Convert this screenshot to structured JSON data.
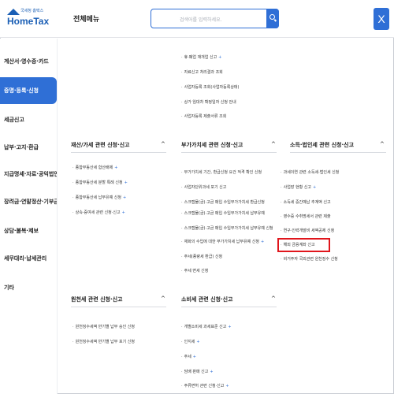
{
  "header": {
    "logo_small": "국세청 홈택스",
    "logo_big": "HomeTax",
    "menu_title": "전체메뉴",
    "search_placeholder": "검색어를 입력하세요.",
    "close_label": "X"
  },
  "sidebar": {
    "items": [
      {
        "label": "계산서·영수증·카드",
        "active": false
      },
      {
        "label": "증명·등록·신청",
        "active": true
      },
      {
        "label": "세금신고",
        "active": false
      },
      {
        "label": "납부·고지·환급",
        "active": false
      },
      {
        "label": "지급명세·자료·공익법인",
        "active": false
      },
      {
        "label": "장려금·연말정산·기부금",
        "active": false
      },
      {
        "label": "상담·불복·제보",
        "active": false
      },
      {
        "label": "세무대리·납세관리",
        "active": false
      },
      {
        "label": "기타",
        "active": false
      }
    ]
  },
  "top_list": [
    {
      "label": "휴·폐업 재개업 신고",
      "plus": true
    },
    {
      "label": "자료신고 처리결과 조회",
      "plus": false
    },
    {
      "label": "사업자등록 조회(사업자등록상태)",
      "plus": false
    },
    {
      "label": "상가 임대차 확정일자 신청 안내",
      "plus": false
    },
    {
      "label": "사업자등록 제출서류 조회",
      "plus": false
    }
  ],
  "sections": {
    "property": {
      "title": "재산/가세 관련 신청·신고",
      "caret": "^",
      "items": [
        {
          "label": "종합부동산세 합산배제",
          "plus": true
        },
        {
          "label": "종합부동산세 분할 특례 신청",
          "plus": true
        },
        {
          "label": "종합부동산세 납부유예 신청",
          "plus": true
        },
        {
          "label": "상속·증여세 관련 신청·신고",
          "plus": true
        }
      ]
    },
    "vat": {
      "title": "부가가치세 관련 신청·신고",
      "caret": "^",
      "items": [
        {
          "label": "부가가치세 기간, 환급신청 요건 적격 확인 신청",
          "plus": false
        },
        {
          "label": "사업자단위과세 포기 신고",
          "plus": false
        },
        {
          "label": "스크랩물(금)·고금 매입 수입부가가치세 환급신청",
          "plus": false
        },
        {
          "label": "스크랩물(금)·고금 매입 수입부가가치세 납부유예",
          "plus": false
        },
        {
          "label": "스크랩물(금)·고금 매입 수입부가가치세 납부유예 신청",
          "plus": false
        },
        {
          "label": "재화의 수입에 대한 부가가치세 납부유예 신청",
          "plus": true
        },
        {
          "label": "주세(종량세 환급) 신청",
          "plus": false
        },
        {
          "label": "주세 면세 신청",
          "plus": false
        }
      ]
    },
    "corporate": {
      "title": "소득·법인세 관련 신청·신고",
      "caret": "^",
      "items": [
        {
          "label": "과세이연 관련 소득세·법인세 신청",
          "plus": false
        },
        {
          "label": "사업장 현황 신고",
          "plus": true
        },
        {
          "label": "소득세 중간예납 추계액 신고",
          "plus": false
        },
        {
          "label": "영수증 수취명세서 관련 제출",
          "plus": false
        },
        {
          "label": "연구·인력개발비 세액공제 신청",
          "plus": false
        },
        {
          "label": "해외 금융계좌 신고",
          "plus": false
        },
        {
          "label": "비거주자 국외관련 원천징수 신청",
          "plus": false
        }
      ]
    },
    "withholding": {
      "title": "원천세 관련 신청·신고",
      "caret": "^",
      "items": [
        {
          "label": "원천징수세액 반기별 납부 승인 신청",
          "plus": false
        },
        {
          "label": "원천징수세액 반기별 납부 포기 신청",
          "plus": false
        }
      ]
    },
    "excise": {
      "title": "소비세 관련 신청·신고",
      "caret": "^",
      "items": [
        {
          "label": "개별소비세 과세표준 신고",
          "plus": true
        },
        {
          "label": "인지세",
          "plus": true
        },
        {
          "label": "주세",
          "plus": true
        },
        {
          "label": "담배 판매 신고",
          "plus": true
        },
        {
          "label": "주류면허 관련 신청·신고",
          "plus": true
        }
      ]
    }
  }
}
